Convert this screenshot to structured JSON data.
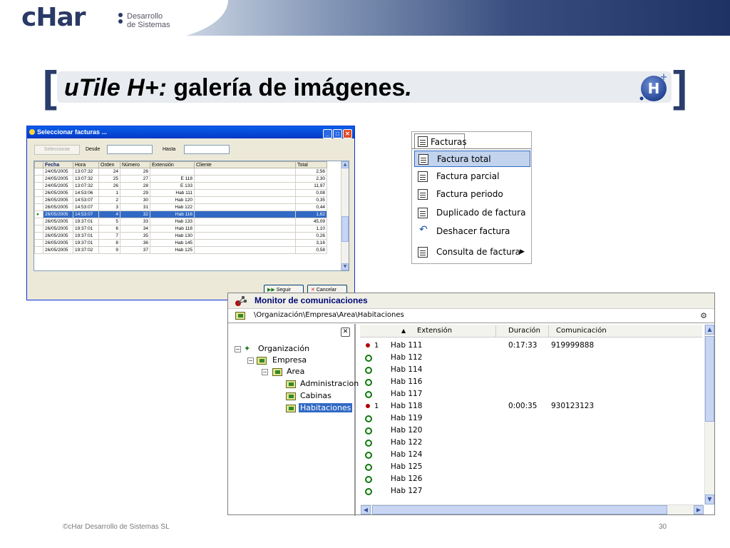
{
  "header": {
    "logo_text": "cHar",
    "logo_sub_1": "Desarrollo",
    "logo_sub_2": "de Sistemas"
  },
  "title": {
    "italic": "uTile H+:",
    "rest": " galería de imágenes",
    "dot": ".",
    "bracket_left": "[",
    "bracket_right": "]",
    "badge_letter": "H",
    "badge_plus": "+"
  },
  "facturas_window": {
    "title": "Seleccionar facturas ...",
    "select_button": "Seleccionar",
    "desde_label": "Desde",
    "hasta_label": "Hasta",
    "columns": [
      "Fecha",
      "Hora",
      "Orden",
      "Número",
      "Extensión",
      "Cliente",
      "Total"
    ],
    "rows": [
      [
        "24/05/2005",
        "13:07:32",
        "24",
        "26",
        "",
        "",
        "2,56"
      ],
      [
        "24/05/2005",
        "13:07:32",
        "25",
        "27",
        "E 118",
        "",
        "2,30"
      ],
      [
        "24/05/2005",
        "13:07:32",
        "26",
        "28",
        "E 133",
        "",
        "11,97"
      ],
      [
        "26/05/2005",
        "14:53:06",
        "1",
        "29",
        "Hab 111",
        "",
        "0,08"
      ],
      [
        "26/05/2005",
        "14:53:07",
        "2",
        "30",
        "Hab 120",
        "",
        "0,35"
      ],
      [
        "26/05/2005",
        "14:53:07",
        "3",
        "31",
        "Hab 122",
        "",
        "0,44"
      ],
      [
        "26/05/2005",
        "14:53:07",
        "4",
        "32",
        "Hab 116",
        "",
        "1,62"
      ],
      [
        "26/05/2005",
        "19:37:01",
        "5",
        "33",
        "Hab 133",
        "",
        "45,09"
      ],
      [
        "26/05/2005",
        "19:37:01",
        "6",
        "34",
        "Hab 118",
        "",
        "1,10"
      ],
      [
        "26/05/2005",
        "19:37:01",
        "7",
        "35",
        "Hab 130",
        "",
        "0,26"
      ],
      [
        "26/05/2005",
        "19:37:01",
        "8",
        "36",
        "Hab 145",
        "",
        "3,16"
      ],
      [
        "26/05/2005",
        "19:37:02",
        "9",
        "37",
        "Hab 125",
        "",
        "0,58"
      ]
    ],
    "selected_row": 6,
    "seguir_button": "Seguir",
    "cancelar_button": "Cancelar"
  },
  "menu": {
    "tab_label": "Facturas",
    "items": [
      {
        "label": "Factura total",
        "icon": "document-icon",
        "highlighted": true
      },
      {
        "label": "Factura parcial",
        "icon": "document-icon"
      },
      {
        "label": "Factura periodo",
        "icon": "document-icon"
      },
      {
        "label": "Duplicado de factura",
        "icon": "copy-document-icon"
      },
      {
        "label": "Deshacer factura",
        "icon": "undo-icon"
      },
      {
        "label": "Consulta de factura",
        "icon": "query-document-icon",
        "submenu": true
      }
    ]
  },
  "monitor": {
    "title": "Monitor de comunicaciones",
    "path": "\\Organización\\Empresa\\Area\\Habitaciones",
    "tree": [
      "Organización",
      "Empresa",
      "Area",
      "Administracion",
      "Cabinas",
      "Habitaciones"
    ],
    "tree_selected": "Habitaciones",
    "columns": [
      "Extensión",
      "Duración",
      "Comunicación"
    ],
    "sort_indicator": "▲",
    "rows": [
      {
        "status": "active",
        "count": "1",
        "ext": "Hab 111",
        "dur": "0:17:33",
        "com": "919999888"
      },
      {
        "status": "idle",
        "count": "",
        "ext": "Hab 112",
        "dur": "",
        "com": ""
      },
      {
        "status": "idle",
        "count": "",
        "ext": "Hab 114",
        "dur": "",
        "com": ""
      },
      {
        "status": "idle",
        "count": "",
        "ext": "Hab 116",
        "dur": "",
        "com": ""
      },
      {
        "status": "idle",
        "count": "",
        "ext": "Hab 117",
        "dur": "",
        "com": ""
      },
      {
        "status": "active",
        "count": "1",
        "ext": "Hab 118",
        "dur": "0:00:35",
        "com": "930123123"
      },
      {
        "status": "idle",
        "count": "",
        "ext": "Hab 119",
        "dur": "",
        "com": ""
      },
      {
        "status": "idle",
        "count": "",
        "ext": "Hab 120",
        "dur": "",
        "com": ""
      },
      {
        "status": "idle",
        "count": "",
        "ext": "Hab 122",
        "dur": "",
        "com": ""
      },
      {
        "status": "idle",
        "count": "",
        "ext": "Hab 124",
        "dur": "",
        "com": ""
      },
      {
        "status": "idle",
        "count": "",
        "ext": "Hab 125",
        "dur": "",
        "com": ""
      },
      {
        "status": "idle",
        "count": "",
        "ext": "Hab 126",
        "dur": "",
        "com": ""
      },
      {
        "status": "idle",
        "count": "",
        "ext": "Hab 127",
        "dur": "",
        "com": ""
      }
    ]
  },
  "footer": {
    "copyright": "©cHar Desarrollo de Sistemas SL",
    "page": "30"
  },
  "colors": {
    "brand_navy": "#2b3d6d",
    "selection_blue": "#316ac5",
    "xp_title_blue": "#0a5ee8"
  }
}
